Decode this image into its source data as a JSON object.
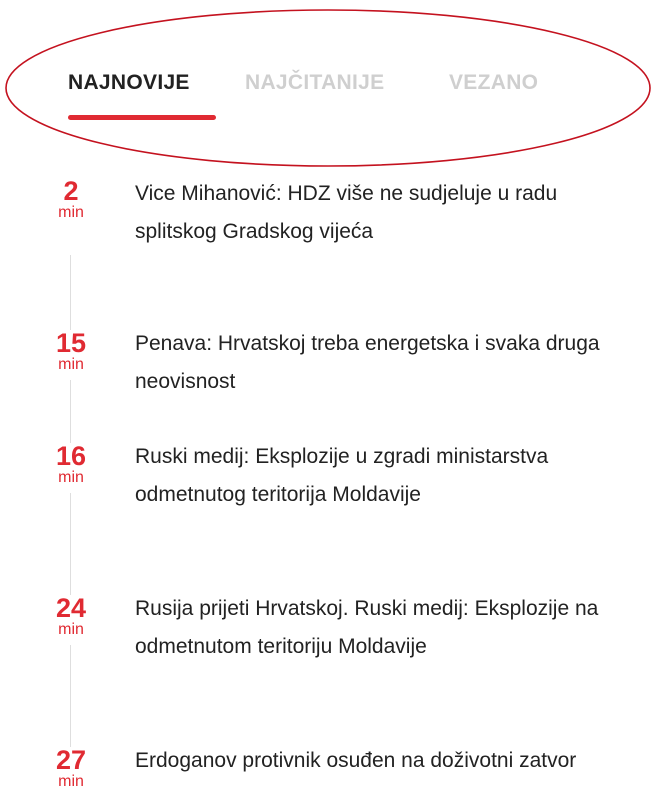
{
  "tabs": [
    {
      "label": "NAJNOVIJE",
      "active": true
    },
    {
      "label": "NAJČITANIJE",
      "active": false
    },
    {
      "label": "VEZANO",
      "active": false
    }
  ],
  "colors": {
    "accent": "#e02a32",
    "active_tab": "#222222",
    "inactive_tab": "#cfcfcf",
    "headline": "#222222",
    "timeline": "#dedede"
  },
  "news": [
    {
      "time": "2",
      "unit": "min",
      "title": "Vice Mihanović: HDZ više ne sudjeluje u radu splitskog Gradskog vijeća"
    },
    {
      "time": "15",
      "unit": "min",
      "title": "Penava: Hrvatskoj treba energetska i svaka druga neovisnost"
    },
    {
      "time": "16",
      "unit": "min",
      "title": "Ruski medij: Eksplozije u zgradi ministarstva odmetnutog teritorija Moldavije"
    },
    {
      "time": "24",
      "unit": "min",
      "title": "Rusija prijeti Hrvatskoj. Ruski medij: Eksplozije na odmetnutom teritoriju Moldavije"
    },
    {
      "time": "27",
      "unit": "min",
      "title": "Erdoganov protivnik osuđen na doživotni zatvor"
    }
  ]
}
